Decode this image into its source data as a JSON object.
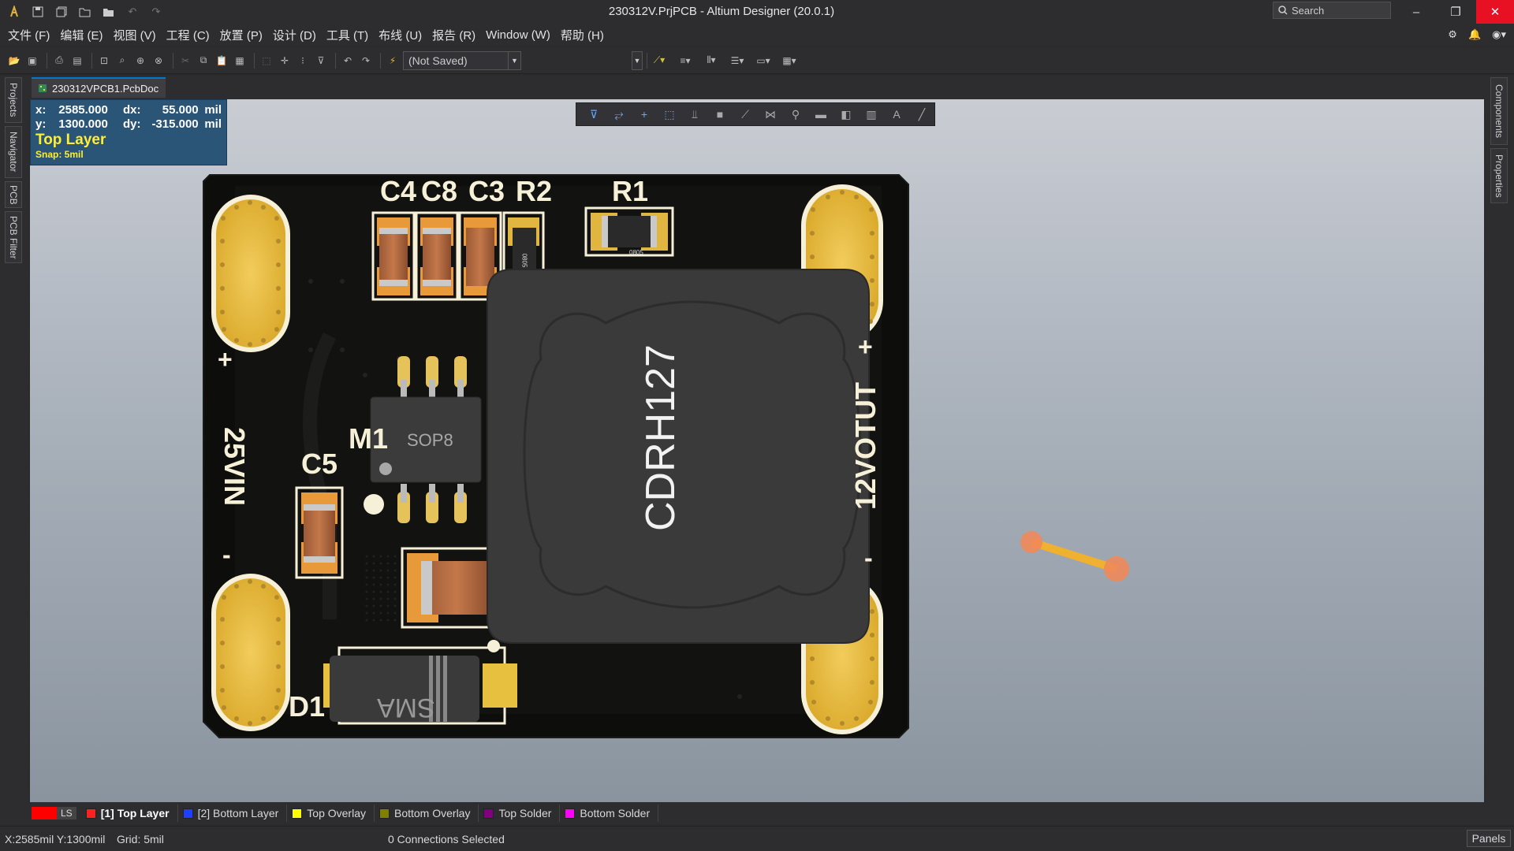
{
  "titlebar": {
    "title": "230312V.PrjPCB - Altium Designer (20.0.1)",
    "search_placeholder": "Search"
  },
  "menu": [
    "文件 (F)",
    "编辑 (E)",
    "视图 (V)",
    "工程 (C)",
    "放置 (P)",
    "设计 (D)",
    "工具 (T)",
    "布线 (U)",
    "报告 (R)",
    "Window (W)",
    "帮助 (H)"
  ],
  "toolbar": {
    "variant_combo": "(Not Saved)"
  },
  "left_panels": [
    "Projects",
    "Navigator",
    "PCB",
    "PCB Filter"
  ],
  "right_panels": [
    "Components",
    "Properties"
  ],
  "document_tab": "230312VPCB1.PcbDoc",
  "hud": {
    "x_label": "x:",
    "x_value": "2585.000",
    "dx_label": "dx:",
    "dx_value": "55.000",
    "y_label": "y:",
    "y_value": "1300.000",
    "dy_label": "dy:",
    "dy_value": "-315.000",
    "unit": "mil",
    "layer": "Top Layer",
    "snap": "Snap: 5mil"
  },
  "pcb": {
    "designators": [
      "C4",
      "C8",
      "C3",
      "R2",
      "R1",
      "C5",
      "M1",
      "D1"
    ],
    "ic_label": "SOP8",
    "inductor_label": "CDRH127",
    "input_label": "25VIN",
    "output_label": "12VOTUT",
    "diode_label": "SMA",
    "r1_value": "0805",
    "r2_value": "0805",
    "plus": "+",
    "minus": "-"
  },
  "layers": [
    {
      "label": "[1] Top Layer",
      "color": "#ff2020",
      "active": true
    },
    {
      "label": "[2] Bottom Layer",
      "color": "#1f3fff",
      "active": false
    },
    {
      "label": "Top Overlay",
      "color": "#ffff00",
      "active": false
    },
    {
      "label": "Bottom Overlay",
      "color": "#808000",
      "active": false
    },
    {
      "label": "Top Solder",
      "color": "#800080",
      "active": false
    },
    {
      "label": "Bottom Solder",
      "color": "#ff00ff",
      "active": false
    }
  ],
  "layer_set_label": "LS",
  "status": {
    "coords": "X:2585mil Y:1300mil",
    "grid": "Grid: 5mil",
    "connections": "0 Connections Selected",
    "panels": "Panels"
  }
}
